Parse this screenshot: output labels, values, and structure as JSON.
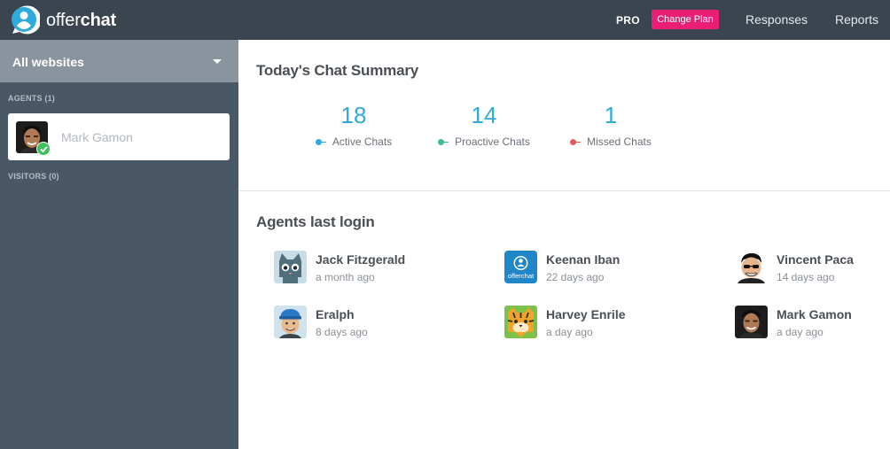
{
  "brand": {
    "name_light": "offer",
    "name_bold": "chat"
  },
  "header": {
    "plan_label": "PRO",
    "change_plan_label": "Change Plan",
    "nav": [
      {
        "label": "Responses"
      },
      {
        "label": "Reports"
      }
    ]
  },
  "sidebar": {
    "website_select": "All websites",
    "agents_heading": "AGENTS (1)",
    "agents": [
      {
        "name": "Mark Gamon",
        "status": "online"
      }
    ],
    "visitors_heading": "VISITORS (0)"
  },
  "summary": {
    "title": "Today's Chat Summary",
    "stats": [
      {
        "value": "18",
        "label": "Active Chats",
        "color": "#2eaadc"
      },
      {
        "value": "14",
        "label": "Proactive Chats",
        "color": "#3dbd8a"
      },
      {
        "value": "1",
        "label": "Missed Chats",
        "color": "#e85a5a"
      }
    ]
  },
  "agents_last_login": {
    "title": "Agents last login",
    "agents": [
      {
        "name": "Jack Fitzgerald",
        "time": "a month ago",
        "avatar": "cat-avatar-icon"
      },
      {
        "name": "Keenan Iban",
        "time": "22 days ago",
        "avatar": "offerchat-avatar-icon",
        "avatar_text": "offerchat"
      },
      {
        "name": "Vincent Paca",
        "time": "14 days ago",
        "avatar": "cartoon-man-avatar-icon"
      },
      {
        "name": "Eralph",
        "time": "8 days ago",
        "avatar": "cap-boy-avatar-icon"
      },
      {
        "name": "Harvey Enrile",
        "time": "a day ago",
        "avatar": "tiger-avatar-icon"
      },
      {
        "name": "Mark Gamon",
        "time": "a day ago",
        "avatar": "photo-man-avatar-icon"
      }
    ]
  }
}
